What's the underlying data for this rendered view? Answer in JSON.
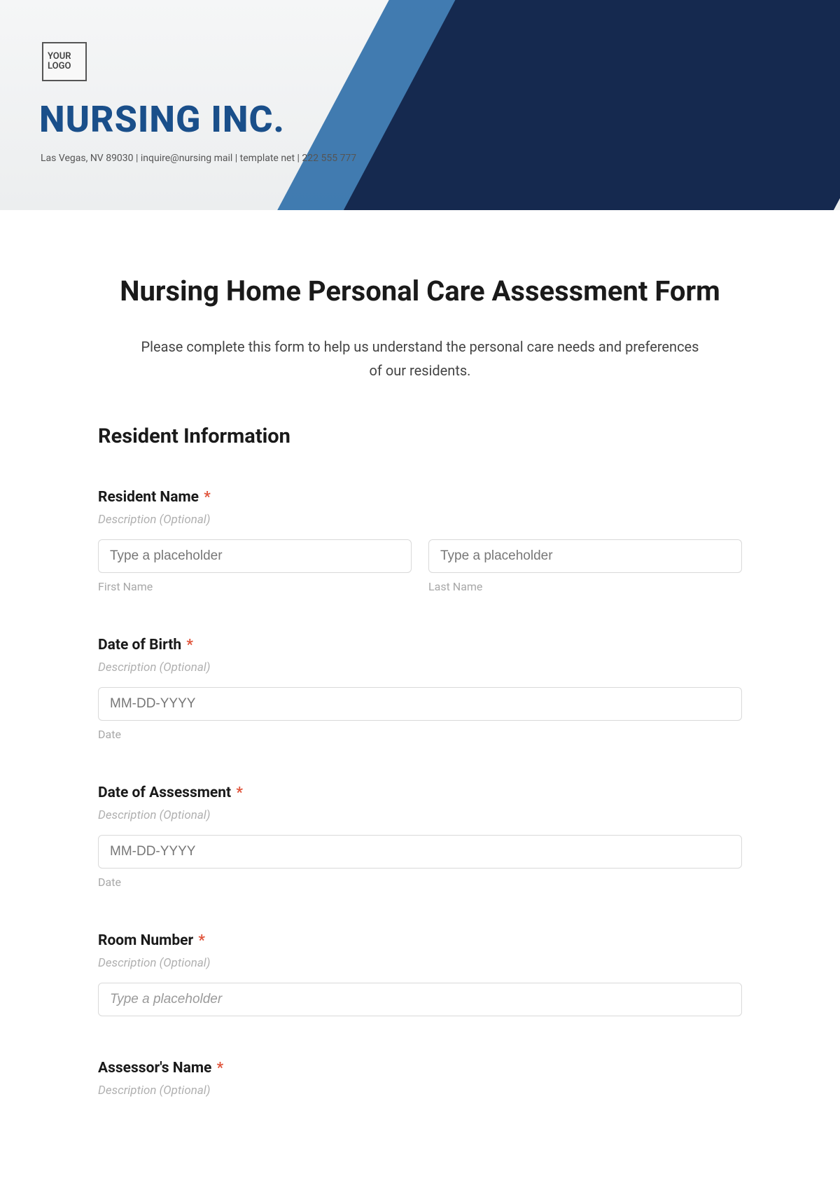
{
  "header": {
    "logo_text": "YOUR LOGO",
    "company_name": "NURSING INC.",
    "contact_line": "Las Vegas, NV 89030 | inquire@nursing mail | template net | 222 555 777"
  },
  "form": {
    "title": "Nursing Home Personal Care Assessment Form",
    "subtitle": "Please complete this form to help us understand the personal care needs and preferences of our residents.",
    "section_title": "Resident Information",
    "description_optional": "Description (Optional)",
    "placeholder_generic": "Type a placeholder",
    "placeholder_date": "MM-DD-YYYY",
    "required_mark": "*",
    "fields": {
      "resident_name": {
        "label": "Resident Name",
        "first_sub": "First Name",
        "last_sub": "Last Name"
      },
      "dob": {
        "label": "Date of Birth",
        "sub": "Date"
      },
      "doa": {
        "label": "Date of Assessment",
        "sub": "Date"
      },
      "room": {
        "label": "Room Number"
      },
      "assessor": {
        "label": "Assessor's Name"
      }
    }
  }
}
